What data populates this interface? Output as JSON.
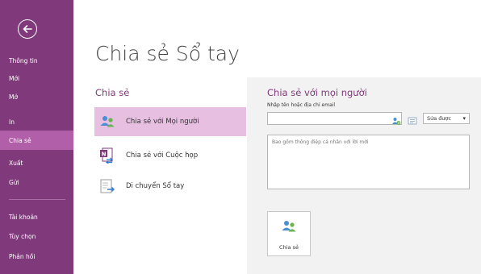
{
  "sidebar": {
    "back": "back",
    "items": [
      {
        "label": "Thông tin",
        "active": false
      },
      {
        "label": "Mới",
        "active": false
      },
      {
        "label": "Mở",
        "active": false
      },
      {
        "label": "In",
        "active": false
      },
      {
        "label": "Chia sẻ",
        "active": true
      },
      {
        "label": "Xuất",
        "active": false
      },
      {
        "label": "Gửi",
        "active": false
      },
      {
        "label": "Tài khoản",
        "active": false
      },
      {
        "label": "Tùy chọn",
        "active": false
      },
      {
        "label": "Phản hồi",
        "active": false
      }
    ]
  },
  "main": {
    "title": "Chia sẻ Sổ tay",
    "section": "Chia sẻ",
    "options": [
      {
        "label": "Chia sẻ với Mọi người",
        "icon": "people-icon",
        "selected": true
      },
      {
        "label": "Chia sẻ với Cuộc họp",
        "icon": "onenote-meeting-icon",
        "selected": false
      },
      {
        "label": "Di chuyển Sổ tay",
        "icon": "move-notebook-icon",
        "selected": false
      }
    ]
  },
  "share_panel": {
    "title": "Chia sẻ với mọi người",
    "email_label": "Nhập tên hoặc địa chỉ email",
    "email_value": "",
    "permission": "Sửa được",
    "message_placeholder": "Bao gồm thông điệp cá nhân với lời mời",
    "share_button": "Chia sẻ"
  },
  "colors": {
    "accent": "#80397b",
    "sidebar_active": "#b05fa8",
    "option_selected": "#e6bfe1",
    "panel_bg": "#f2f2f2"
  }
}
